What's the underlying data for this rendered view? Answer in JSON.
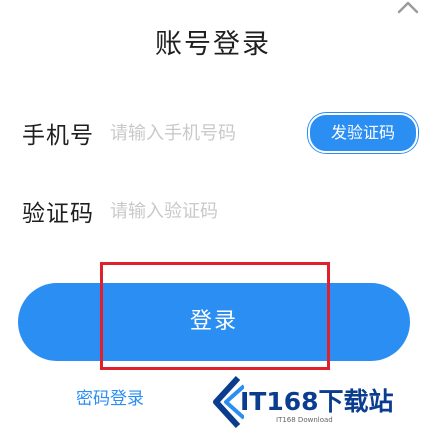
{
  "header": {
    "title": "账号登录",
    "collapse_icon": "chevron-up-icon"
  },
  "phone_field": {
    "label": "手机号",
    "placeholder": "请输入手机号码",
    "value": ""
  },
  "code_field": {
    "label": "验证码",
    "placeholder": "请输入验证码",
    "value": ""
  },
  "send_code_button": {
    "label": "发验证码"
  },
  "login_button": {
    "label": "登录"
  },
  "password_login_link": {
    "label": "密码登录"
  },
  "watermark": {
    "brand": "IT168下载站",
    "sub": "IT168 Download"
  },
  "colors": {
    "accent": "#2b8ef3",
    "highlight": "#e0202a",
    "placeholder": "#c9c9c9"
  }
}
